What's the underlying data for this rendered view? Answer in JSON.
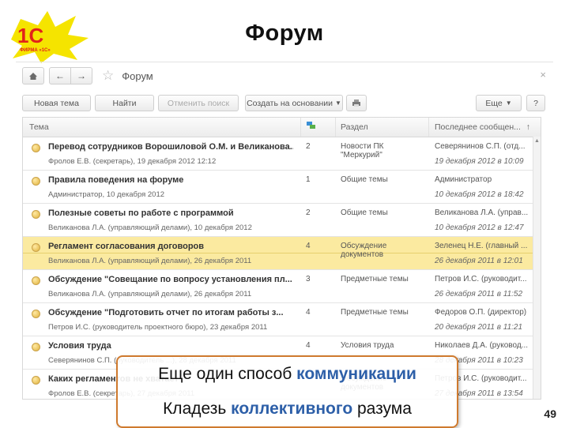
{
  "slide": {
    "title": "Форум",
    "page_number": "49"
  },
  "logo": {
    "mark": "1С",
    "text": "ФИРМА «1С»",
    "brand_color": "#e2231a",
    "splash_color": "#f5e400"
  },
  "window": {
    "title": "Форум",
    "nav": {
      "home_icon": "home-icon",
      "back_icon": "arrow-left-icon",
      "forward_icon": "arrow-right-icon",
      "favorite_icon": "star-icon"
    }
  },
  "toolbar": {
    "new_topic": "Новая тема",
    "find": "Найти",
    "cancel_search": "Отменить поиск",
    "create_based_on": "Создать на основании",
    "more": "Еще",
    "help": "?"
  },
  "table": {
    "columns": [
      "Тема",
      "",
      "Раздел",
      "Последнее сообщен..."
    ],
    "rows": [
      {
        "topic": "Перевод сотрудников Ворошиловой О.М. и Великанова...",
        "author": "Фролов Е.В. (секретарь), 19 декабря 2012 12:12",
        "count": "2",
        "section": "Новости ПК \"Меркурий\"",
        "last": "Северянинов С.П. (отд...",
        "date": "19 декабря 2012 в 10:09",
        "selected": false
      },
      {
        "topic": "Правила поведения на форуме",
        "author": "Администратор, 10 декабря 2012",
        "count": "1",
        "section": "Общие темы",
        "last": "Администратор",
        "date": "10 декабря 2012 в 18:42",
        "selected": false
      },
      {
        "topic": "Полезные советы по работе с программой",
        "author": "Великанова Л.А. (управляющий делами), 10 декабря 2012",
        "count": "2",
        "section": "Общие темы",
        "last": "Великанова Л.А. (управ...",
        "date": "10 декабря 2012 в 12:47",
        "selected": false
      },
      {
        "topic": "Регламент согласования договоров",
        "author": "Великанова Л.А. (управляющий делами), 26 декабря 2011",
        "count": "4",
        "section": "Обсуждение документов",
        "last": "Зеленец Н.Е. (главный ...",
        "date": "26 декабря 2011 в 12:01",
        "selected": true
      },
      {
        "topic": "Обсуждение \"Совещание по вопросу установления пл...",
        "author": "Великанова Л.А. (управляющий делами), 26 декабря 2011",
        "count": "3",
        "section": "Предметные темы",
        "last": "Петров И.С. (руководит...",
        "date": "26 декабря 2011 в 11:52",
        "selected": false
      },
      {
        "topic": "Обсуждение \"Подготовить отчет по итогам работы з...",
        "author": "Петров И.С. (руководитель проектного бюро), 23 декабря 2011",
        "count": "4",
        "section": "Предметные темы",
        "last": "Федоров О.П. (директор)",
        "date": "20 декабря 2011 в 11:21",
        "selected": false
      },
      {
        "topic": "Условия труда",
        "author": "Северянинов С.П. (руководитель ...), 28 декабря 2011",
        "count": "4",
        "section": "Условия труда",
        "last": "Николаев Д.А. (руковод...",
        "date": "28 декабря 2011 в 10:23",
        "selected": false
      },
      {
        "topic": "Каких регламентов не хватает",
        "author": "Фролов Е.В. (секретарь), 27 декабря 2011",
        "count": "",
        "section": "Обсуждение документов",
        "last": "Петров И.С. (руководит...",
        "date": "27 декабря 2011 в 13:54",
        "selected": false
      }
    ]
  },
  "callout": {
    "line1_a": "Еще один способ ",
    "line1_b": "коммуникации",
    "line2_a": "Кладезь ",
    "line2_b": "коллективного",
    "line2_c": " разума",
    "border_color": "#cf7a2e",
    "highlight_color": "#2d5fa8"
  }
}
